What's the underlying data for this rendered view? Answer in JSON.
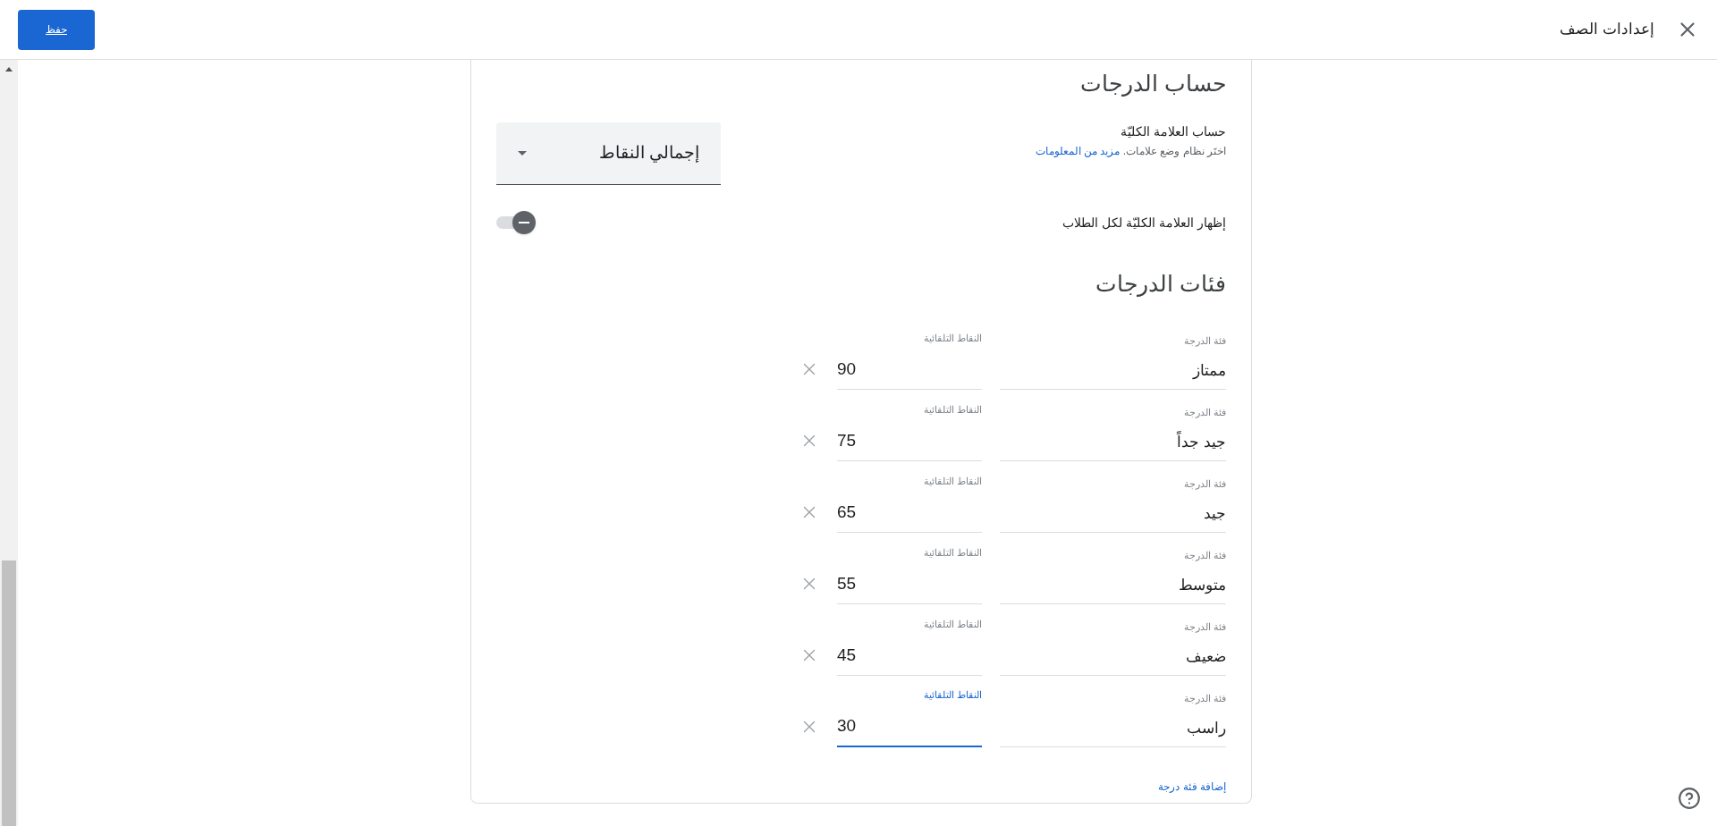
{
  "header": {
    "title": "إعدادات الصف",
    "save_button": "حفظ"
  },
  "grading": {
    "heading": "حساب الدرجات",
    "overall": {
      "label": "حساب العلامة الكليّة",
      "hint": "اختَر نظام وضع علامات.",
      "link": "مزيد من المعلومات",
      "value": "إجمالي النقاط"
    },
    "show_overall": {
      "label": "إظهار العلامة الكليّة لكل الطلاب",
      "on": false
    }
  },
  "categories": {
    "heading": "فئات الدرجات",
    "rows": [
      {
        "name_label": "فئة الدرجة",
        "name": "ممتاز",
        "points_label": "النقاط التلقائية",
        "points": "90",
        "focused": false
      },
      {
        "name_label": "فئة الدرجة",
        "name": "جيد جداً",
        "points_label": "النقاط التلقائية",
        "points": "75",
        "focused": false
      },
      {
        "name_label": "فئة الدرجة",
        "name": "جيد",
        "points_label": "النقاط التلقائية",
        "points": "65",
        "focused": false
      },
      {
        "name_label": "فئة الدرجة",
        "name": "متوسط",
        "points_label": "النقاط التلقائية",
        "points": "55",
        "focused": false
      },
      {
        "name_label": "فئة الدرجة",
        "name": "ضعيف",
        "points_label": "النقاط التلقائية",
        "points": "45",
        "focused": false
      },
      {
        "name_label": "فئة الدرجة",
        "name": "راسب",
        "points_label": "النقاط التلقائية",
        "points": "30",
        "focused": true
      }
    ],
    "add_link": "إضافة فئة درجة"
  }
}
